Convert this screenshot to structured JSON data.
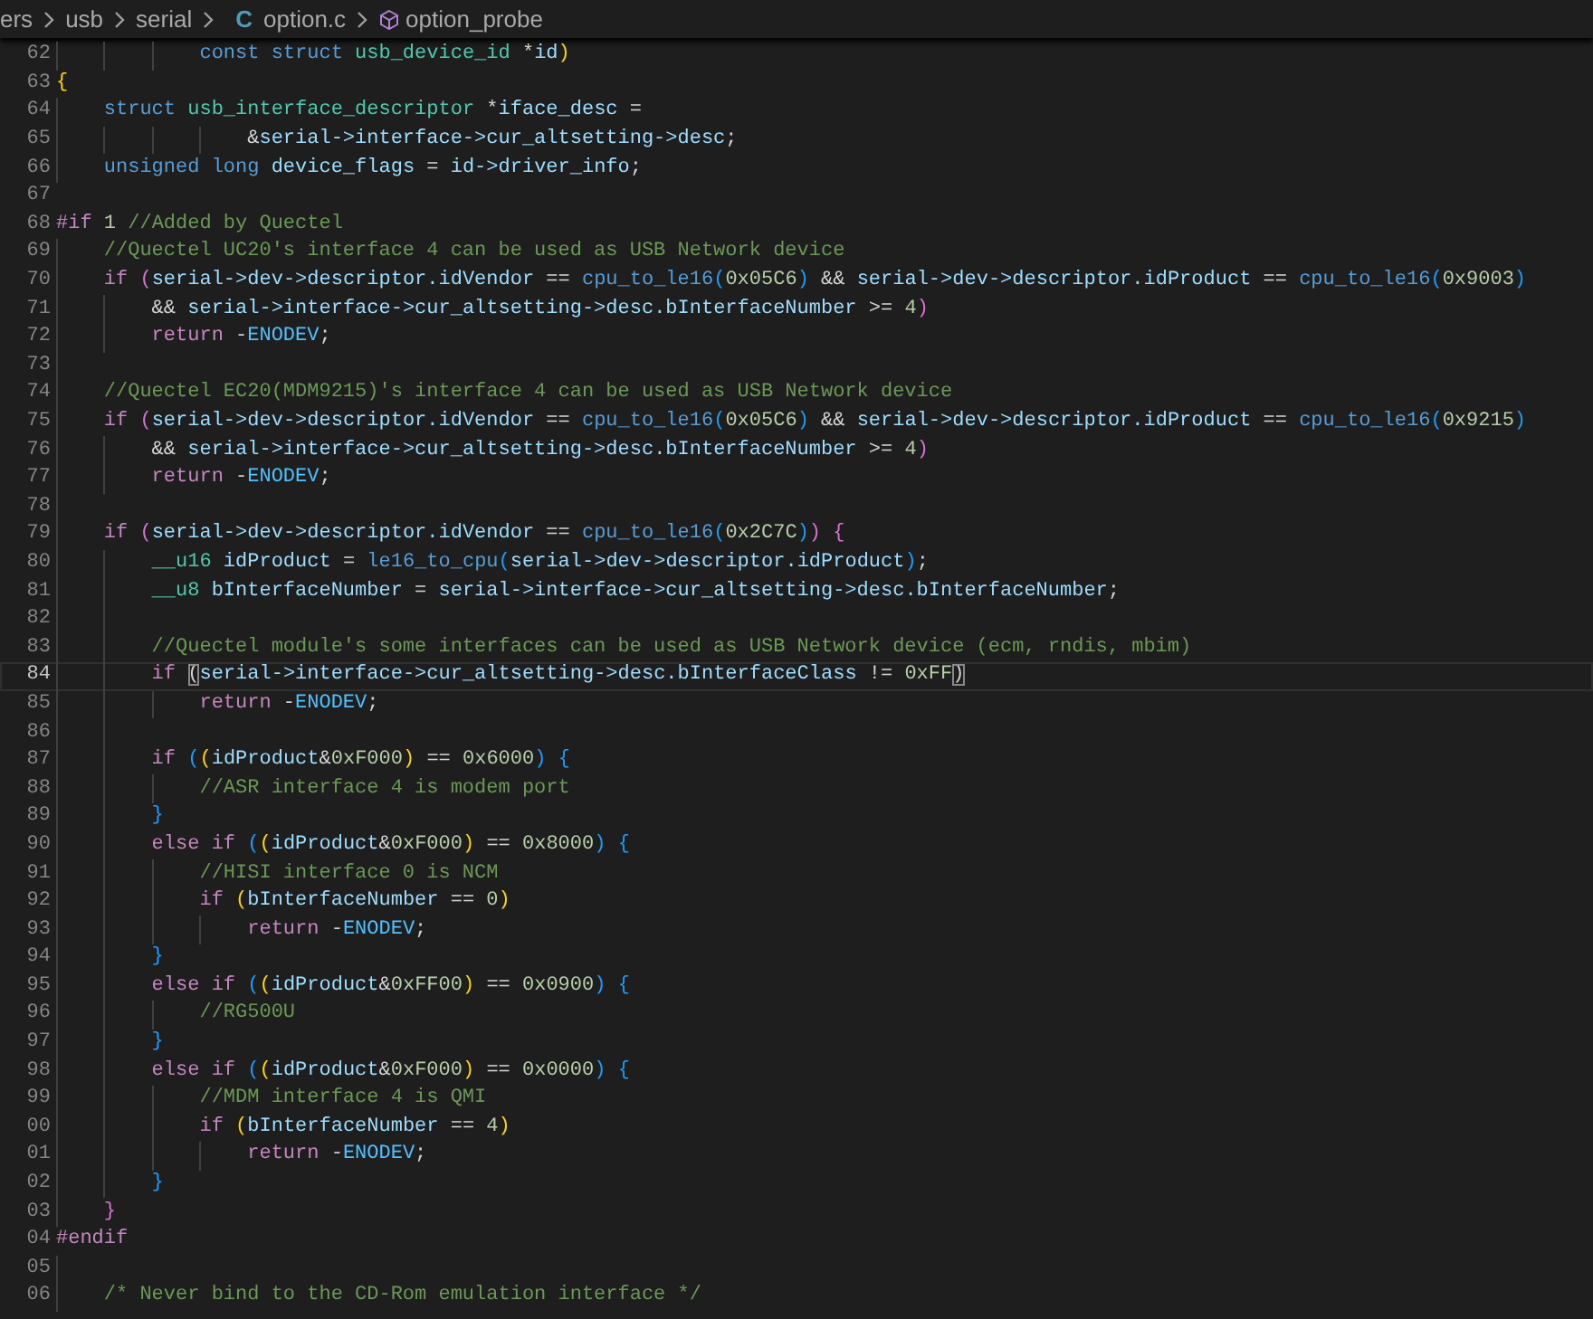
{
  "breadcrumb": {
    "items": [
      {
        "text": "ers"
      },
      {
        "text": "usb"
      },
      {
        "text": "serial"
      },
      {
        "text": "option.c",
        "file_icon": "C"
      },
      {
        "text": "option_probe",
        "symbol": true
      }
    ]
  },
  "lines": [
    {
      "number": "62",
      "current": false,
      "tokens": [
        {
          "text": "            const struct ",
          "kind": "keyword"
        },
        {
          "text": "usb_device_id",
          "kind": "type"
        },
        {
          "text": " *",
          "kind": "plain"
        },
        {
          "text": "id",
          "kind": "variable"
        },
        {
          "text": ")",
          "kind": "bracket1"
        }
      ]
    },
    {
      "number": "63",
      "current": false,
      "tokens": [
        {
          "text": "{",
          "kind": "bracket1"
        }
      ]
    },
    {
      "number": "64",
      "current": false,
      "tokens": [
        {
          "text": "    struct ",
          "kind": "keyword"
        },
        {
          "text": "usb_interface_descriptor",
          "kind": "type"
        },
        {
          "text": " *",
          "kind": "plain"
        },
        {
          "text": "iface_desc",
          "kind": "variable"
        },
        {
          "text": " =",
          "kind": "plain"
        }
      ]
    },
    {
      "number": "65",
      "current": false,
      "tokens": [
        {
          "text": "                &",
          "kind": "plain"
        },
        {
          "text": "serial->interface->cur_altsetting->desc",
          "kind": "variable"
        },
        {
          "text": ";",
          "kind": "plain"
        }
      ]
    },
    {
      "number": "66",
      "current": false,
      "tokens": [
        {
          "text": "    unsigned long ",
          "kind": "keyword"
        },
        {
          "text": "device_flags",
          "kind": "variable"
        },
        {
          "text": " = ",
          "kind": "plain"
        },
        {
          "text": "id->driver_info",
          "kind": "variable"
        },
        {
          "text": ";",
          "kind": "plain"
        }
      ]
    },
    {
      "number": "67",
      "current": false
    },
    {
      "number": "68",
      "current": false,
      "tokens": [
        {
          "text": "#if",
          "kind": "control"
        },
        {
          "text": " 1",
          "kind": "number"
        },
        {
          "text": " //Added by Quectel",
          "kind": "comment"
        }
      ]
    },
    {
      "number": "69",
      "current": false,
      "tokens": [
        {
          "text": "    //Quectel UC20's interface 4 can be used as USB Network device",
          "kind": "comment"
        }
      ]
    },
    {
      "number": "70",
      "current": false,
      "tokens": [
        {
          "text": "    if ",
          "kind": "control"
        },
        {
          "text": "(",
          "kind": "bracket2"
        },
        {
          "text": "serial->dev->descriptor.idVendor",
          "kind": "variable"
        },
        {
          "text": " == ",
          "kind": "plain"
        },
        {
          "text": "cpu_to_le16",
          "kind": "keyword"
        },
        {
          "text": "(",
          "kind": "bracket3"
        },
        {
          "text": "0x05C6",
          "kind": "number"
        },
        {
          "text": ")",
          "kind": "bracket3"
        },
        {
          "text": " && ",
          "kind": "plain"
        },
        {
          "text": "serial->dev->descriptor.idProduct",
          "kind": "variable"
        },
        {
          "text": " == ",
          "kind": "plain"
        },
        {
          "text": "cpu_to_le16",
          "kind": "keyword"
        },
        {
          "text": "(",
          "kind": "bracket3"
        },
        {
          "text": "0x9003",
          "kind": "number"
        },
        {
          "text": ")",
          "kind": "bracket3"
        }
      ]
    },
    {
      "number": "71",
      "current": false,
      "tokens": [
        {
          "text": "        && ",
          "kind": "plain"
        },
        {
          "text": "serial->interface->cur_altsetting->desc.bInterfaceNumber",
          "kind": "variable"
        },
        {
          "text": " >= ",
          "kind": "plain"
        },
        {
          "text": "4",
          "kind": "number"
        },
        {
          "text": ")",
          "kind": "bracket2"
        }
      ]
    },
    {
      "number": "72",
      "current": false,
      "tokens": [
        {
          "text": "        return",
          "kind": "control"
        },
        {
          "text": " -",
          "kind": "plain"
        },
        {
          "text": "ENODEV",
          "kind": "macro"
        },
        {
          "text": ";",
          "kind": "plain"
        }
      ]
    },
    {
      "number": "73",
      "current": false
    },
    {
      "number": "74",
      "current": false,
      "tokens": [
        {
          "text": "    //Quectel EC20(MDM9215)'s interface 4 can be used as USB Network device",
          "kind": "comment"
        }
      ]
    },
    {
      "number": "75",
      "current": false,
      "tokens": [
        {
          "text": "    if ",
          "kind": "control"
        },
        {
          "text": "(",
          "kind": "bracket2"
        },
        {
          "text": "serial->dev->descriptor.idVendor",
          "kind": "variable"
        },
        {
          "text": " == ",
          "kind": "plain"
        },
        {
          "text": "cpu_to_le16",
          "kind": "keyword"
        },
        {
          "text": "(",
          "kind": "bracket3"
        },
        {
          "text": "0x05C6",
          "kind": "number"
        },
        {
          "text": ")",
          "kind": "bracket3"
        },
        {
          "text": " && ",
          "kind": "plain"
        },
        {
          "text": "serial->dev->descriptor.idProduct",
          "kind": "variable"
        },
        {
          "text": " == ",
          "kind": "plain"
        },
        {
          "text": "cpu_to_le16",
          "kind": "keyword"
        },
        {
          "text": "(",
          "kind": "bracket3"
        },
        {
          "text": "0x9215",
          "kind": "number"
        },
        {
          "text": ")",
          "kind": "bracket3"
        }
      ]
    },
    {
      "number": "76",
      "current": false,
      "tokens": [
        {
          "text": "        && ",
          "kind": "plain"
        },
        {
          "text": "serial->interface->cur_altsetting->desc.bInterfaceNumber",
          "kind": "variable"
        },
        {
          "text": " >= ",
          "kind": "plain"
        },
        {
          "text": "4",
          "kind": "number"
        },
        {
          "text": ")",
          "kind": "bracket2"
        }
      ]
    },
    {
      "number": "77",
      "current": false,
      "tokens": [
        {
          "text": "        return",
          "kind": "control"
        },
        {
          "text": " -",
          "kind": "plain"
        },
        {
          "text": "ENODEV",
          "kind": "macro"
        },
        {
          "text": ";",
          "kind": "plain"
        }
      ]
    },
    {
      "number": "78",
      "current": false
    },
    {
      "number": "79",
      "current": false,
      "tokens": [
        {
          "text": "    if ",
          "kind": "control"
        },
        {
          "text": "(",
          "kind": "bracket2"
        },
        {
          "text": "serial->dev->descriptor.idVendor",
          "kind": "variable"
        },
        {
          "text": " == ",
          "kind": "plain"
        },
        {
          "text": "cpu_to_le16",
          "kind": "keyword"
        },
        {
          "text": "(",
          "kind": "bracket3"
        },
        {
          "text": "0x2C7C",
          "kind": "number"
        },
        {
          "text": ")",
          "kind": "bracket3"
        },
        {
          "text": ")",
          "kind": "bracket2"
        },
        {
          "text": " {",
          "kind": "bracket2"
        }
      ]
    },
    {
      "number": "80",
      "current": false,
      "tokens": [
        {
          "text": "        __u16",
          "kind": "type"
        },
        {
          "text": " idProduct",
          "kind": "variable"
        },
        {
          "text": " = ",
          "kind": "plain"
        },
        {
          "text": "le16_to_cpu",
          "kind": "keyword"
        },
        {
          "text": "(",
          "kind": "bracket3"
        },
        {
          "text": "serial->dev->descriptor.idProduct",
          "kind": "variable"
        },
        {
          "text": ")",
          "kind": "bracket3"
        },
        {
          "text": ";",
          "kind": "plain"
        }
      ]
    },
    {
      "number": "81",
      "current": false,
      "tokens": [
        {
          "text": "        __u8",
          "kind": "type"
        },
        {
          "text": " bInterfaceNumber",
          "kind": "variable"
        },
        {
          "text": " = ",
          "kind": "plain"
        },
        {
          "text": "serial->interface->cur_altsetting->desc.bInterfaceNumber",
          "kind": "variable"
        },
        {
          "text": ";",
          "kind": "plain"
        }
      ]
    },
    {
      "number": "82",
      "current": false
    },
    {
      "number": "83",
      "current": false,
      "tokens": [
        {
          "text": "        //Quectel module's some interfaces can be used as USB Network device (ecm, rndis, mbim)",
          "kind": "comment"
        }
      ]
    },
    {
      "number": "84",
      "current": true,
      "tokens": [
        {
          "text": "        if ",
          "kind": "control"
        },
        {
          "text": "(",
          "kind": "match"
        },
        {
          "text": "serial->interface->cur_altsetting->desc.bInterfaceClass",
          "kind": "variable"
        },
        {
          "text": " != ",
          "kind": "plain"
        },
        {
          "text": "0xFF",
          "kind": "number"
        },
        {
          "text": ")",
          "kind": "match"
        }
      ]
    },
    {
      "number": "85",
      "current": false,
      "tokens": [
        {
          "text": "            return",
          "kind": "control"
        },
        {
          "text": " -",
          "kind": "plain"
        },
        {
          "text": "ENODEV",
          "kind": "macro"
        },
        {
          "text": ";",
          "kind": "plain"
        }
      ]
    },
    {
      "number": "86",
      "current": false
    },
    {
      "number": "87",
      "current": false,
      "tokens": [
        {
          "text": "        if ",
          "kind": "control"
        },
        {
          "text": "(",
          "kind": "bracket3"
        },
        {
          "text": "(",
          "kind": "bracket1"
        },
        {
          "text": "idProduct",
          "kind": "variable"
        },
        {
          "text": "&",
          "kind": "plain"
        },
        {
          "text": "0xF000",
          "kind": "number"
        },
        {
          "text": ")",
          "kind": "bracket1"
        },
        {
          "text": " == ",
          "kind": "plain"
        },
        {
          "text": "0x6000",
          "kind": "number"
        },
        {
          "text": ")",
          "kind": "bracket3"
        },
        {
          "text": " {",
          "kind": "bracket3"
        }
      ]
    },
    {
      "number": "88",
      "current": false,
      "tokens": [
        {
          "text": "            //ASR interface 4 is modem port",
          "kind": "comment"
        }
      ]
    },
    {
      "number": "89",
      "current": false,
      "tokens": [
        {
          "text": "        }",
          "kind": "bracket3"
        }
      ]
    },
    {
      "number": "90",
      "current": false,
      "tokens": [
        {
          "text": "        else if ",
          "kind": "control"
        },
        {
          "text": "(",
          "kind": "bracket3"
        },
        {
          "text": "(",
          "kind": "bracket1"
        },
        {
          "text": "idProduct",
          "kind": "variable"
        },
        {
          "text": "&",
          "kind": "plain"
        },
        {
          "text": "0xF000",
          "kind": "number"
        },
        {
          "text": ")",
          "kind": "bracket1"
        },
        {
          "text": " == ",
          "kind": "plain"
        },
        {
          "text": "0x8000",
          "kind": "number"
        },
        {
          "text": ")",
          "kind": "bracket3"
        },
        {
          "text": " {",
          "kind": "bracket3"
        }
      ]
    },
    {
      "number": "91",
      "current": false,
      "tokens": [
        {
          "text": "            //HISI interface 0 is NCM",
          "kind": "comment"
        }
      ]
    },
    {
      "number": "92",
      "current": false,
      "tokens": [
        {
          "text": "            if ",
          "kind": "control"
        },
        {
          "text": "(",
          "kind": "bracket1"
        },
        {
          "text": "bInterfaceNumber",
          "kind": "variable"
        },
        {
          "text": " == ",
          "kind": "plain"
        },
        {
          "text": "0",
          "kind": "number"
        },
        {
          "text": ")",
          "kind": "bracket1"
        }
      ]
    },
    {
      "number": "93",
      "current": false,
      "tokens": [
        {
          "text": "                return",
          "kind": "control"
        },
        {
          "text": " -",
          "kind": "plain"
        },
        {
          "text": "ENODEV",
          "kind": "macro"
        },
        {
          "text": ";",
          "kind": "plain"
        }
      ]
    },
    {
      "number": "94",
      "current": false,
      "tokens": [
        {
          "text": "        }",
          "kind": "bracket3"
        }
      ]
    },
    {
      "number": "95",
      "current": false,
      "tokens": [
        {
          "text": "        else if ",
          "kind": "control"
        },
        {
          "text": "(",
          "kind": "bracket3"
        },
        {
          "text": "(",
          "kind": "bracket1"
        },
        {
          "text": "idProduct",
          "kind": "variable"
        },
        {
          "text": "&",
          "kind": "plain"
        },
        {
          "text": "0xFF00",
          "kind": "number"
        },
        {
          "text": ")",
          "kind": "bracket1"
        },
        {
          "text": " == ",
          "kind": "plain"
        },
        {
          "text": "0x0900",
          "kind": "number"
        },
        {
          "text": ")",
          "kind": "bracket3"
        },
        {
          "text": " {",
          "kind": "bracket3"
        }
      ]
    },
    {
      "number": "96",
      "current": false,
      "tokens": [
        {
          "text": "            //RG500U",
          "kind": "comment"
        }
      ]
    },
    {
      "number": "97",
      "current": false,
      "tokens": [
        {
          "text": "        }",
          "kind": "bracket3"
        }
      ]
    },
    {
      "number": "98",
      "current": false,
      "tokens": [
        {
          "text": "        else if ",
          "kind": "control"
        },
        {
          "text": "(",
          "kind": "bracket3"
        },
        {
          "text": "(",
          "kind": "bracket1"
        },
        {
          "text": "idProduct",
          "kind": "variable"
        },
        {
          "text": "&",
          "kind": "plain"
        },
        {
          "text": "0xF000",
          "kind": "number"
        },
        {
          "text": ")",
          "kind": "bracket1"
        },
        {
          "text": " == ",
          "kind": "plain"
        },
        {
          "text": "0x0000",
          "kind": "number"
        },
        {
          "text": ")",
          "kind": "bracket3"
        },
        {
          "text": " {",
          "kind": "bracket3"
        }
      ]
    },
    {
      "number": "99",
      "current": false,
      "tokens": [
        {
          "text": "            //MDM interface 4 is QMI",
          "kind": "comment"
        }
      ]
    },
    {
      "number": "00",
      "current": false,
      "tokens": [
        {
          "text": "            if ",
          "kind": "control"
        },
        {
          "text": "(",
          "kind": "bracket1"
        },
        {
          "text": "bInterfaceNumber",
          "kind": "variable"
        },
        {
          "text": " == ",
          "kind": "plain"
        },
        {
          "text": "4",
          "kind": "number"
        },
        {
          "text": ")",
          "kind": "bracket1"
        }
      ]
    },
    {
      "number": "01",
      "current": false,
      "tokens": [
        {
          "text": "                return",
          "kind": "control"
        },
        {
          "text": " -",
          "kind": "plain"
        },
        {
          "text": "ENODEV",
          "kind": "macro"
        },
        {
          "text": ";",
          "kind": "plain"
        }
      ]
    },
    {
      "number": "02",
      "current": false,
      "tokens": [
        {
          "text": "        }",
          "kind": "bracket3"
        }
      ]
    },
    {
      "number": "03",
      "current": false,
      "tokens": [
        {
          "text": "    }",
          "kind": "bracket2"
        }
      ]
    },
    {
      "number": "04",
      "current": false,
      "tokens": [
        {
          "text": "#endif",
          "kind": "control"
        }
      ]
    },
    {
      "number": "05",
      "current": false
    },
    {
      "number": "06",
      "current": false,
      "tokens": [
        {
          "text": "    /* Never bind to the CD-Rom emulation interface */",
          "kind": "comment"
        }
      ]
    }
  ]
}
